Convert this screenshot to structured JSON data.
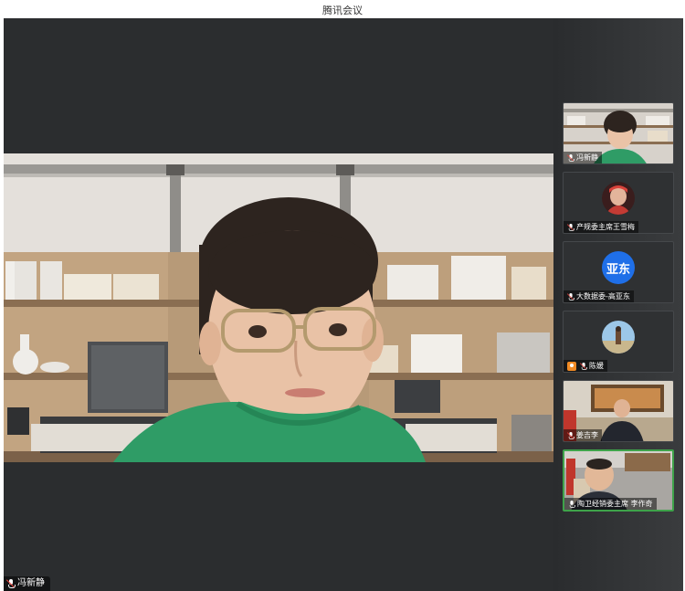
{
  "window": {
    "title": "腾讯会议"
  },
  "main": {
    "speaker_name": "冯新静"
  },
  "participants": [
    {
      "name": "冯新静",
      "type": "video",
      "muted": true
    },
    {
      "name": "产规委主席王雪梅",
      "type": "avatar-photo",
      "muted": true
    },
    {
      "name": "大数据委-高亚东",
      "type": "avatar-text",
      "avatar_text": "亚东",
      "muted": true
    },
    {
      "name": "陈媛",
      "type": "avatar-photo",
      "muted": true,
      "is_host": true
    },
    {
      "name": "姜吉李",
      "type": "video",
      "muted": true
    },
    {
      "name": "陶卫经销委主席 李作奇",
      "type": "video",
      "muted": false,
      "active": true
    }
  ]
}
